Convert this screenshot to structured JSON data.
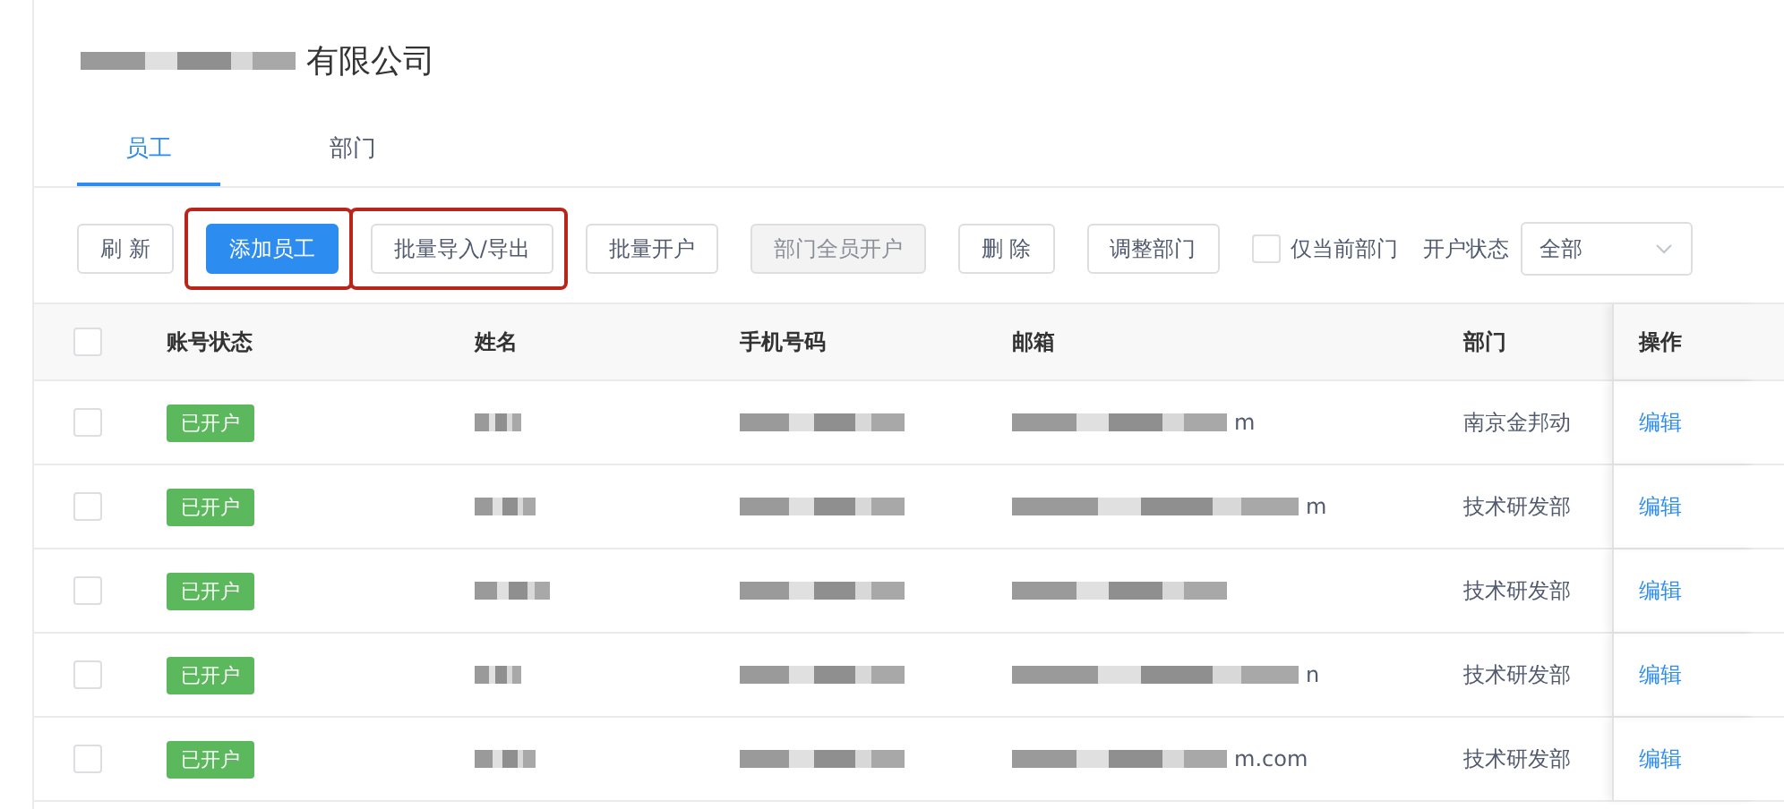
{
  "company": {
    "name": "有限公司"
  },
  "tabs": [
    {
      "label": "员工",
      "selected": true
    },
    {
      "label": "部门",
      "selected": false
    }
  ],
  "toolbar": {
    "buttons": [
      {
        "label": "刷 新",
        "kind": "default",
        "disabled": false,
        "highlighted": false
      },
      {
        "label": "添加员工",
        "kind": "primary",
        "disabled": false,
        "highlighted": true
      },
      {
        "label": "批量导入/导出",
        "kind": "default",
        "disabled": false,
        "highlighted": true
      },
      {
        "label": "批量开户",
        "kind": "default",
        "disabled": false,
        "highlighted": false
      },
      {
        "label": "部门全员开户",
        "kind": "default",
        "disabled": true,
        "highlighted": false
      },
      {
        "label": "删 除",
        "kind": "default",
        "disabled": false,
        "highlighted": false
      },
      {
        "label": "调整部门",
        "kind": "default",
        "disabled": false,
        "highlighted": false
      }
    ],
    "current_dept_only": {
      "label": "仅当前部门",
      "checked": false
    },
    "status_filter": {
      "label": "开户状态",
      "value": "全部"
    }
  },
  "table": {
    "select_all": {
      "checked": false
    },
    "columns": [
      "账号状态",
      "姓名",
      "手机号码",
      "邮箱",
      "部门",
      "操作"
    ],
    "rows": [
      {
        "checked": false,
        "status": "已开户",
        "email_tail": "m",
        "department": "南京金邦动",
        "action": "编辑"
      },
      {
        "checked": false,
        "status": "已开户",
        "email_tail": "m",
        "department": "技术研发部",
        "action": "编辑"
      },
      {
        "checked": false,
        "status": "已开户",
        "department": "技术研发部",
        "action": "编辑"
      },
      {
        "checked": false,
        "status": "已开户",
        "email_tail": "n",
        "department": "技术研发部",
        "action": "编辑"
      },
      {
        "checked": false,
        "status": "已开户",
        "email_tail": "m.com",
        "department": "技术研发部",
        "action": "编辑"
      }
    ]
  }
}
